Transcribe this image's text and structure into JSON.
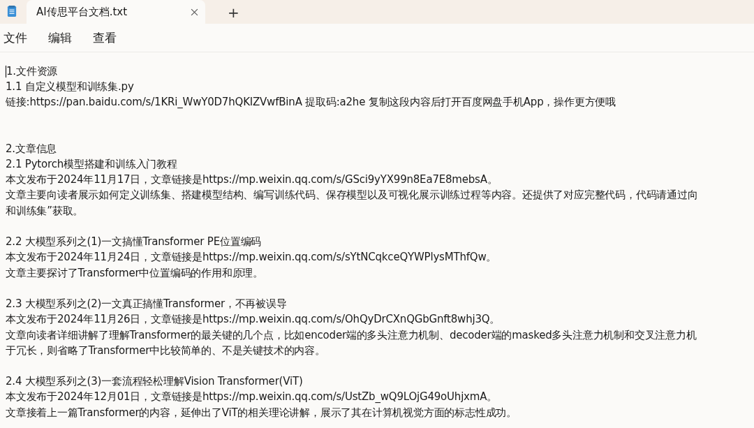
{
  "tabs": [
    {
      "title": "AI传思平台文档.txt",
      "selected": true
    }
  ],
  "new_tab": "+",
  "menu": [
    "文件",
    "编辑",
    "查看"
  ],
  "paragraphs": [
    [
      "1.文件资源",
      "1.1 自定义模型和训练集.py",
      "链接:https://pan.baidu.com/s/1KRi_WwY0D7hQKIZVwfBinA 提取码:a2he 复制这段内容后打开百度网盘手机App，操作更方便哦"
    ],
    [
      "2.文章信息",
      "2.1 Pytorch模型搭建和训练入门教程",
      "本文发布于2024年11月17日，文章链接是https://mp.weixin.qq.com/s/GSci9yYX99n8Ea7E8mebsA。",
      "文章主要向读者展示如何定义训练集、搭建模型结构、编写训练代码、保存模型以及可视化展示训练过程等内容。还提供了对应完整代码，代码请通过向",
      "和训练集”获取。"
    ],
    [
      "2.2 大模型系列之(1)一文搞懂Transformer PE位置编码",
      "本文发布于2024年11月24日，文章链接是https://mp.weixin.qq.com/s/sYtNCqkceQYWPlysMThfQw。",
      "文章主要探讨了Transformer中位置编码的作用和原理。"
    ],
    [
      "2.3 大模型系列之(2)一文真正搞懂Transformer，不再被误导",
      "本文发布于2024年11月26日，文章链接是https://mp.weixin.qq.com/s/OhQyDrCXnQGbGnft8whj3Q。",
      "文章向读者详细讲解了理解Transformer的最关键的几个点，比如encoder端的多头注意力机制、decoder端的masked多头注意力机制和交叉注意力机",
      "于冗长，则省略了Transformer中比较简单的、不是关键技术的内容。"
    ],
    [
      "2.4 大模型系列之(3)一套流程轻松理解Vision Transformer(ViT)",
      "本文发布于2024年12月01日，文章链接是https://mp.weixin.qq.com/s/UstZb_wQ9LOjG49oUhjxmA。",
      "文章接着上一篇Transformer的内容，延伸出了ViT的相关理论讲解，展示了其在计算机视觉方面的标志性成功。"
    ]
  ]
}
